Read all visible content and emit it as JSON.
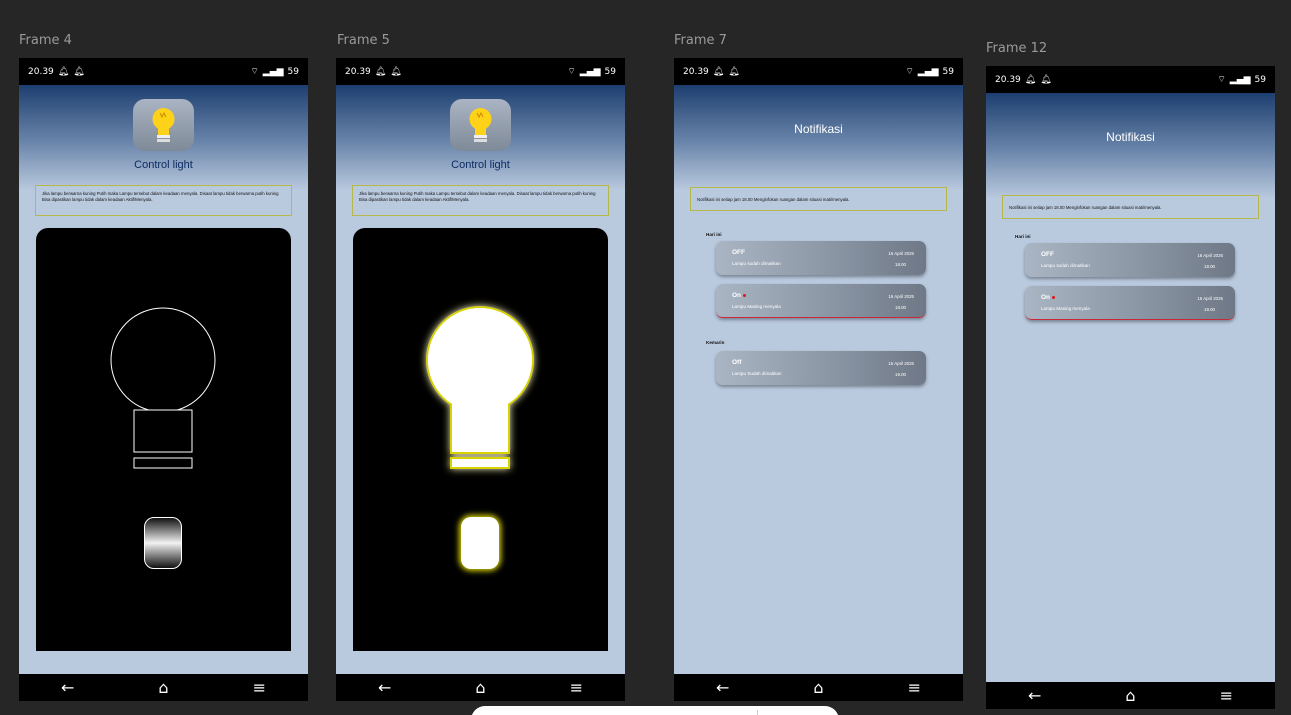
{
  "status": {
    "time": "20.39",
    "battery": "59"
  },
  "nav": {
    "back": "←",
    "home": "⌂",
    "menu": "≡"
  },
  "frames": [
    {
      "label": "Frame 4"
    },
    {
      "label": "Frame 5"
    },
    {
      "label": "Frame 7"
    },
    {
      "label": "Frame 12"
    }
  ],
  "control": {
    "title": "Control light",
    "info": "Jika lampu berwarna kuning Putih maka Lampu tersebut dalam keadaan menyala. Disaat lampu tidak berwarna putih kuning Bisa dipastikan lampu tidak dalam keadaan Aktif/Menyala."
  },
  "notif": {
    "title": "Notifikasi",
    "info": "Notifikasi ini setiap jam 18.00 Menginfokan ruangan dalam situasi mati/menyala.",
    "today_label": "Hari ini",
    "yesterday_label": "Kemarin",
    "today": [
      {
        "status": "OFF",
        "desc": "Lampu sudah dimatikan",
        "date": "16 April 2025",
        "time": "18.00"
      },
      {
        "status": "On",
        "desc": "Lampu Masing menyala",
        "date": "16 April 2025",
        "time": "18.00"
      }
    ],
    "yesterday": [
      {
        "status": "Off",
        "desc": "Lampu Sudah dimatikan",
        "date": "15 April 2025",
        "time": "19.00"
      }
    ]
  },
  "colors": {
    "accent_title": "#0e2c63",
    "alert_dot": "#e01818",
    "glow": "#d8d200"
  }
}
